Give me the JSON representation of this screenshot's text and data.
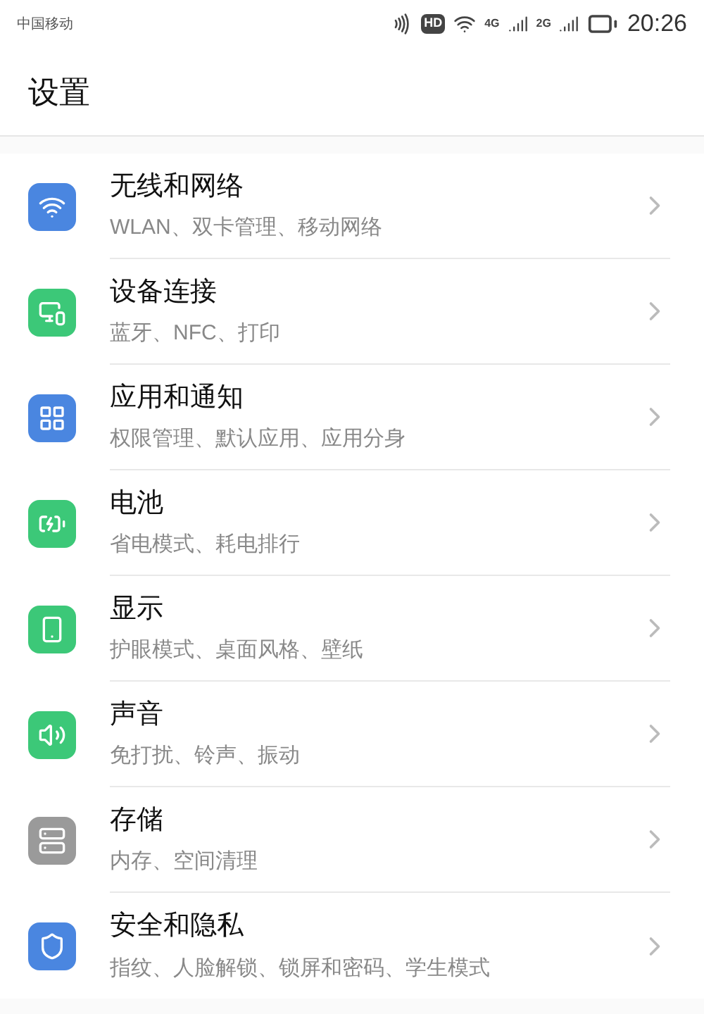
{
  "status_bar": {
    "carrier": "中国移动",
    "hd_badge": "HD",
    "network_1": "4G",
    "network_2": "2G",
    "time": "20:26"
  },
  "title": "设置",
  "items": [
    {
      "kind": "wifi",
      "color": "#4a86e0",
      "title": "无线和网络",
      "subtitle": "WLAN、双卡管理、移动网络"
    },
    {
      "kind": "devices",
      "color": "#3cc878",
      "title": "设备连接",
      "subtitle": "蓝牙、NFC、打印"
    },
    {
      "kind": "apps",
      "color": "#4a86e0",
      "title": "应用和通知",
      "subtitle": "权限管理、默认应用、应用分身"
    },
    {
      "kind": "battery",
      "color": "#3cc878",
      "title": "电池",
      "subtitle": "省电模式、耗电排行"
    },
    {
      "kind": "display",
      "color": "#3cc878",
      "title": "显示",
      "subtitle": "护眼模式、桌面风格、壁纸"
    },
    {
      "kind": "sound",
      "color": "#3cc878",
      "title": "声音",
      "subtitle": "免打扰、铃声、振动"
    },
    {
      "kind": "storage",
      "color": "#9a9a9a",
      "title": "存储",
      "subtitle": "内存、空间清理"
    },
    {
      "kind": "security",
      "color": "#4a86e0",
      "title": "安全和隐私",
      "subtitle": "指纹、人脸解锁、锁屏和密码、学生模式"
    }
  ]
}
